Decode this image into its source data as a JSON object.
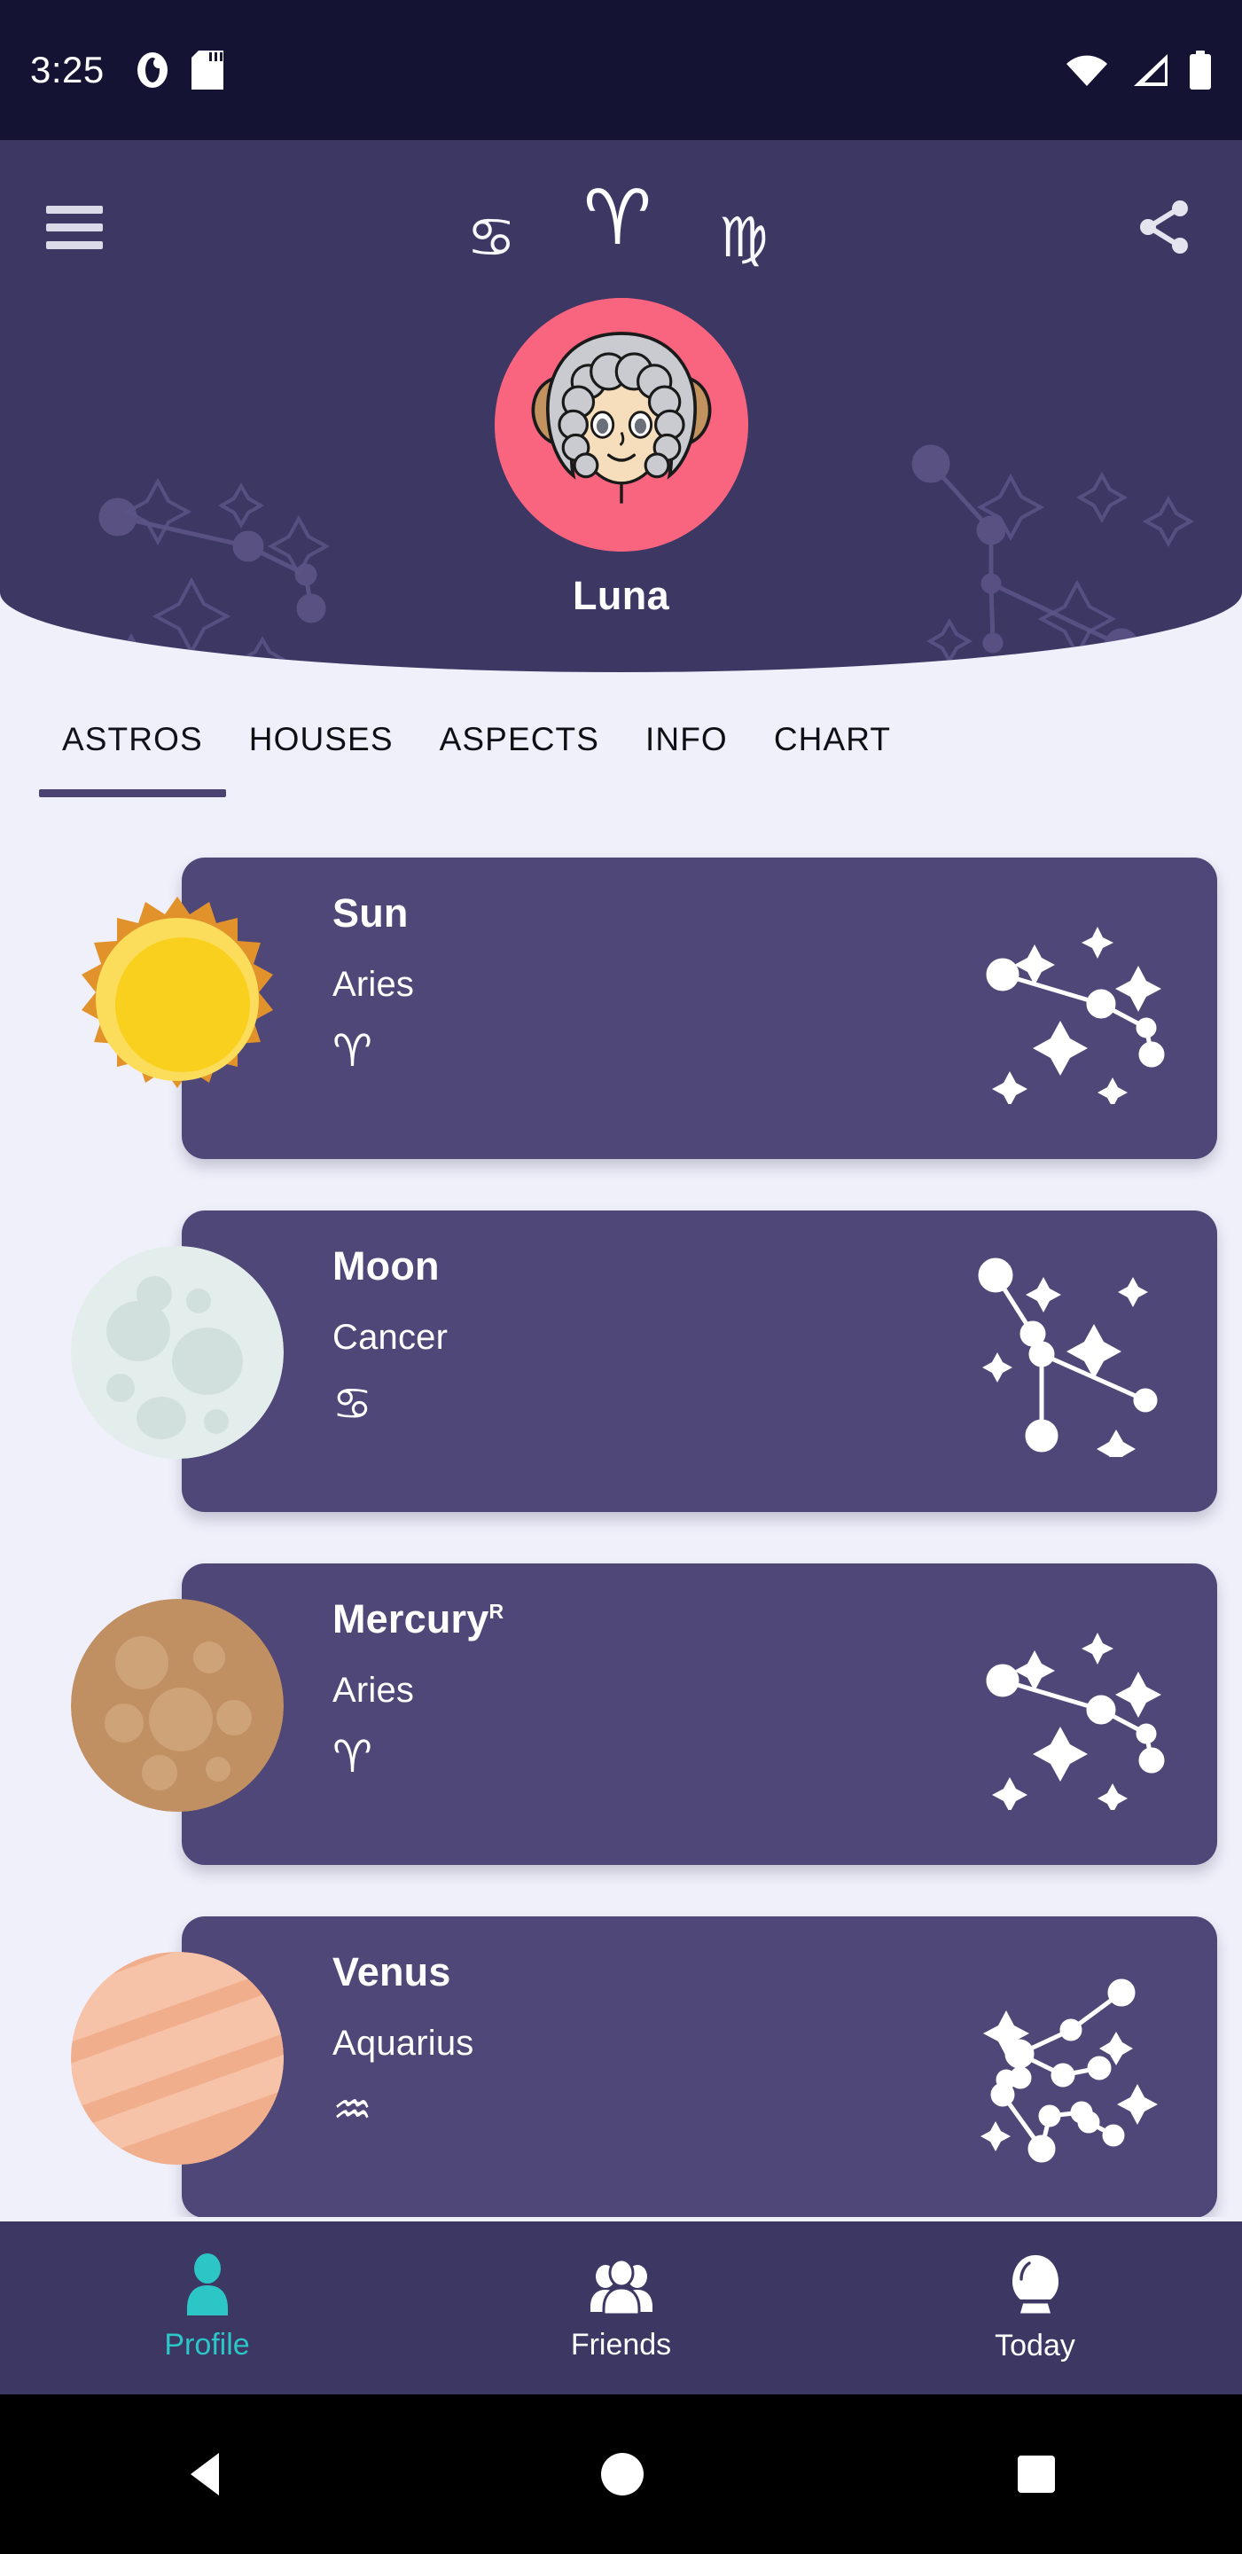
{
  "status_bar": {
    "time": "3:25",
    "left_icons": [
      "app-notification-icon",
      "sd-card-icon"
    ],
    "right_icons": [
      "wifi-icon",
      "cell-signal-icon",
      "battery-icon"
    ]
  },
  "header": {
    "menu_icon": "hamburger-menu-icon",
    "share_icon": "share-icon",
    "zodiac_symbols": [
      {
        "name": "Cancer",
        "glyph": "♋",
        "size": "small"
      },
      {
        "name": "Aries",
        "glyph": "♈",
        "size": "large"
      },
      {
        "name": "Virgo",
        "glyph": "♍",
        "size": "small"
      }
    ],
    "avatar": "aries-ram-avatar",
    "profile_name": "Luna",
    "background_color": "#3D3764",
    "avatar_circle_color": "#F9657F"
  },
  "tabs": [
    {
      "label": "ASTROS",
      "active": true
    },
    {
      "label": "HOUSES",
      "active": false
    },
    {
      "label": "ASPECTS",
      "active": false
    },
    {
      "label": "INFO",
      "active": false
    },
    {
      "label": "CHART",
      "active": false
    }
  ],
  "astros": [
    {
      "planet": "Sun",
      "retrograde": "",
      "sign": "Aries",
      "sign_glyph": "♈",
      "planet_icon": "sun-icon",
      "constellation": "aries-constellation"
    },
    {
      "planet": "Moon",
      "retrograde": "",
      "sign": "Cancer",
      "sign_glyph": "♋",
      "planet_icon": "moon-icon",
      "constellation": "cancer-constellation"
    },
    {
      "planet": "Mercury",
      "retrograde": "R",
      "sign": "Aries",
      "sign_glyph": "♈",
      "planet_icon": "mercury-icon",
      "constellation": "aries-constellation"
    },
    {
      "planet": "Venus",
      "retrograde": "",
      "sign": "Aquarius",
      "sign_glyph": "♒",
      "planet_icon": "venus-icon",
      "constellation": "aquarius-constellation"
    }
  ],
  "bottom_nav": [
    {
      "label": "Profile",
      "icon": "person-icon",
      "active": true
    },
    {
      "label": "Friends",
      "icon": "group-icon",
      "active": false
    },
    {
      "label": "Today",
      "icon": "crystal-ball-icon",
      "active": false
    }
  ],
  "android_nav": {
    "back": "back-triangle-icon",
    "home": "home-circle-icon",
    "recents": "recents-square-icon"
  },
  "colors": {
    "page_background": "#F0F0FB",
    "card": "#4E4777",
    "header": "#3D3764",
    "status_bar": "#141334",
    "accent_teal": "#2CC6C6",
    "tab_indicator": "#4A4372"
  }
}
